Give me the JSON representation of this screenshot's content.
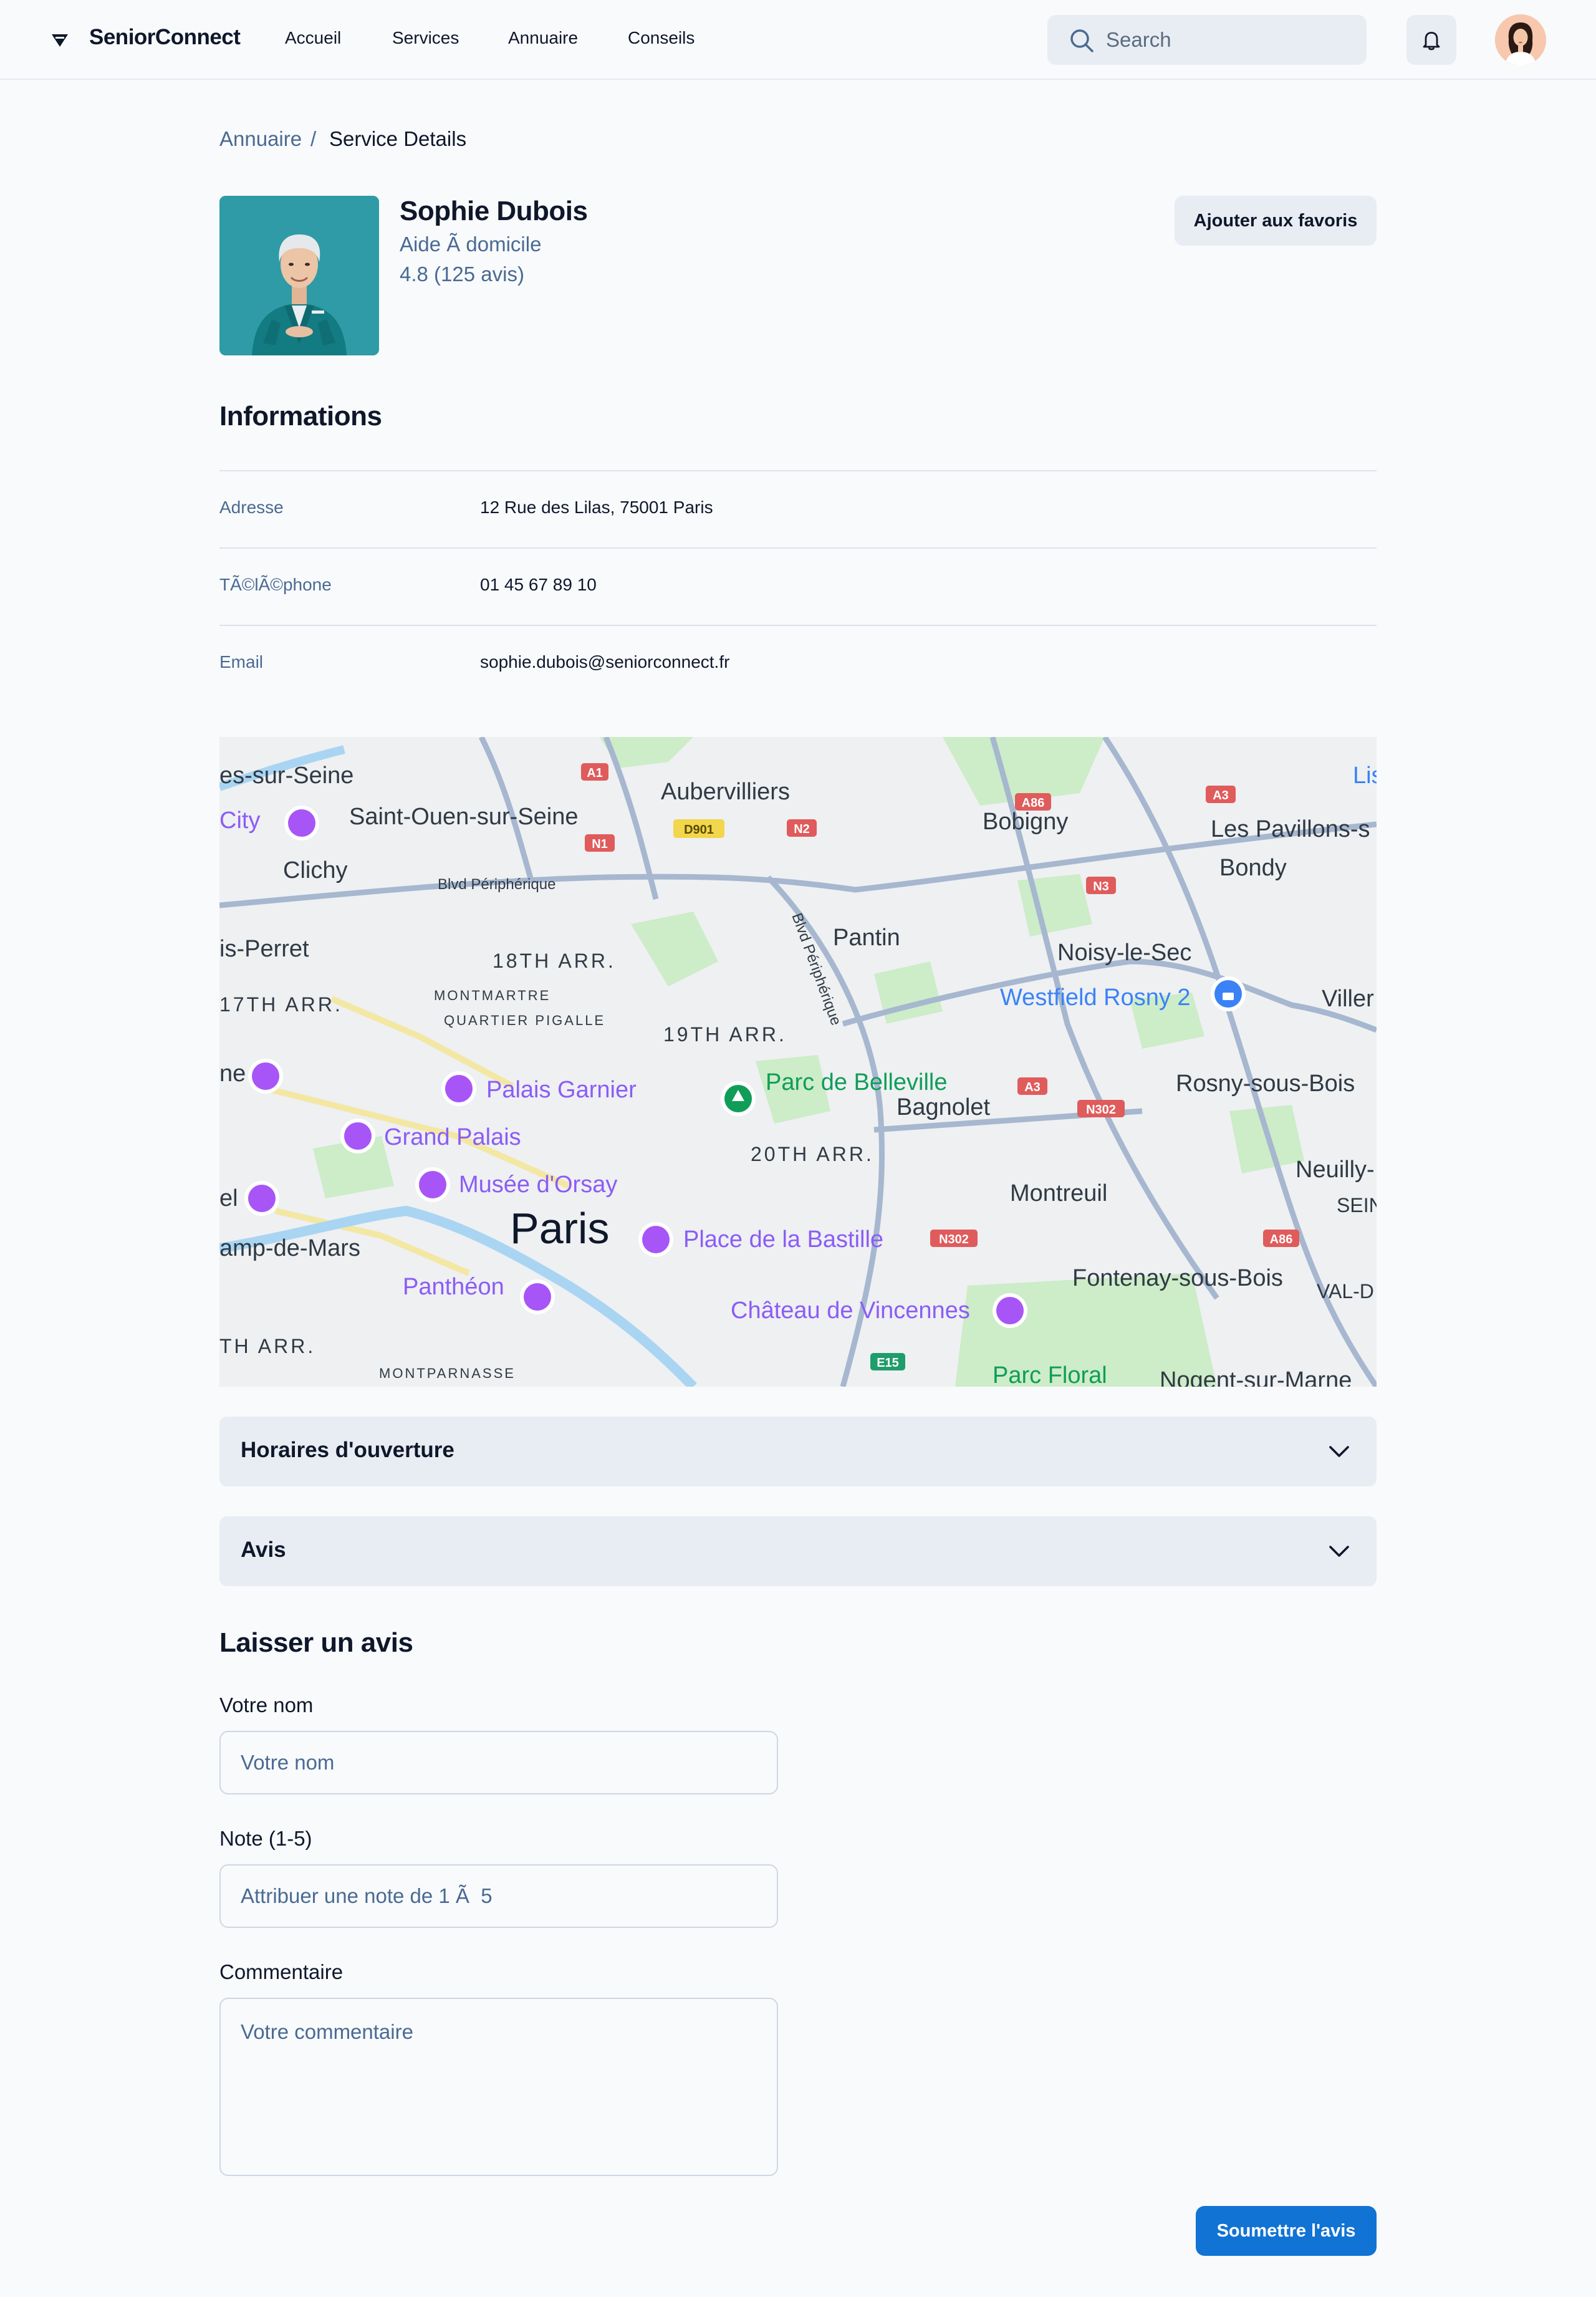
{
  "header": {
    "brand": "SeniorConnect",
    "nav": [
      "Accueil",
      "Services",
      "Annuaire",
      "Conseils"
    ],
    "search_placeholder": "Search",
    "icons": {
      "search": "search-icon",
      "notifications": "bell-icon",
      "profile": "user-avatar"
    }
  },
  "breadcrumb": {
    "parent": "Annuaire",
    "separator": "/",
    "current": "Service Details"
  },
  "profile": {
    "name": "Sophie Dubois",
    "role": "Aide Ã  domicile",
    "rating": "4.8 (125 avis)",
    "favorite_button": "Ajouter aux favoris"
  },
  "informations": {
    "title": "Informations",
    "rows": [
      {
        "label": "Adresse",
        "value": "12 Rue des Lilas, 75001 Paris"
      },
      {
        "label": "TÃ©lÃ©phone",
        "value": "01 45 67 89 10"
      },
      {
        "label": "Email",
        "value": "sophie.dubois@seniorconnect.fr"
      }
    ]
  },
  "map": {
    "places": [
      "es-sur-Seine",
      "City",
      "Saint-Ouen-sur-Seine",
      "Aubervilliers",
      "Bobigny",
      "Les Pavillons-s",
      "Bondy",
      "Lis",
      "Clichy",
      "Blvd Périphérique",
      "Pantin",
      "Noisy-le-Sec",
      "is-Perret",
      "18TH ARR.",
      "MONTMARTRE",
      "QUARTIER PIGALLE",
      "17TH ARR.",
      "19TH ARR.",
      "Westfield Rosny 2",
      "Viller",
      "Palais Garnier",
      "Parc de Belleville",
      "Bagnolet",
      "Rosny-sous-Bois",
      "ne",
      "Grand Palais",
      "20TH ARR.",
      "Neuilly-",
      "SEIN",
      "Musée d'Orsay",
      "Montreuil",
      "el",
      "Paris",
      "Place de la Bastille",
      "amp-de-Mars",
      "Fontenay-sous-Bois",
      "VAL-D",
      "Panthéon",
      "Château de Vincennes",
      "TH ARR.",
      "MONTPARNASSE",
      "Parc Floral",
      "Nogent-sur-Marne",
      "Blvd Périphérique"
    ],
    "road_shields": [
      "A1",
      "A86",
      "A3",
      "N1",
      "D901",
      "N2",
      "N3",
      "A3",
      "N302",
      "N302",
      "A86",
      "E15"
    ]
  },
  "accordions": [
    {
      "title": "Horaires d'ouverture"
    },
    {
      "title": "Avis"
    }
  ],
  "review_form": {
    "title": "Laisser un avis",
    "name_label": "Votre nom",
    "name_placeholder": "Votre nom",
    "rating_label": "Note (1-5)",
    "rating_placeholder": "Attribuer une note de 1 Ã  5",
    "comment_label": "Commentaire",
    "comment_placeholder": "Votre commentaire",
    "submit": "Soumettre l'avis"
  },
  "colors": {
    "accent": "#1173d4",
    "muted_text": "#4a6a92",
    "surface": "#e8edf3",
    "background": "#f8fafc"
  }
}
